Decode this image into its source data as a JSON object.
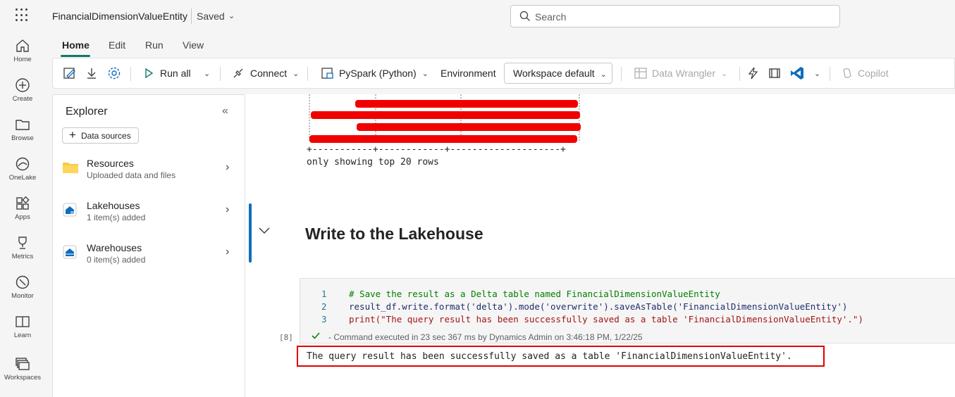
{
  "header": {
    "doc_title": "FinancialDimensionValueEntity",
    "saved_label": "Saved",
    "search_placeholder": "Search"
  },
  "leftnav": {
    "items": [
      {
        "label": "Home",
        "icon": "home-icon"
      },
      {
        "label": "Create",
        "icon": "create-icon"
      },
      {
        "label": "Browse",
        "icon": "browse-icon"
      },
      {
        "label": "OneLake",
        "icon": "onelake-icon"
      },
      {
        "label": "Apps",
        "icon": "apps-icon"
      },
      {
        "label": "Metrics",
        "icon": "metrics-icon"
      },
      {
        "label": "Monitor",
        "icon": "monitor-icon"
      },
      {
        "label": "Learn",
        "icon": "learn-icon"
      },
      {
        "label": "Workspaces",
        "icon": "workspaces-icon"
      }
    ]
  },
  "ribbon": {
    "tabs": [
      "Home",
      "Edit",
      "Run",
      "View"
    ],
    "active_tab": "Home",
    "run_all": "Run all",
    "connect": "Connect",
    "language": "PySpark (Python)",
    "environment": "Environment",
    "workspace": "Workspace default",
    "data_wrangler": "Data Wrangler",
    "copilot": "Copilot"
  },
  "explorer": {
    "title": "Explorer",
    "data_sources_button": "Data sources",
    "items": [
      {
        "name": "Resources",
        "sub": "Uploaded data and files",
        "icon": "folder-icon"
      },
      {
        "name": "Lakehouses",
        "sub": "1 item(s) added",
        "icon": "lakehouse-icon"
      },
      {
        "name": "Warehouses",
        "sub": "0 item(s) added",
        "icon": "warehouse-icon"
      }
    ]
  },
  "notebook": {
    "table_footer": "+-----------+------------+--------------------+",
    "table_note": "only showing top 20 rows",
    "section_heading": "Write to the Lakehouse",
    "code_lines": [
      {
        "num": "1",
        "text": "# Save the result as a Delta table named FinancialDimensionValueEntity"
      },
      {
        "num": "2",
        "text": "result_df.write.format('delta').mode('overwrite').saveAsTable('FinancialDimensionValueEntity')"
      },
      {
        "num": "3",
        "text": "print(\"The query result has been successfully saved as a table 'FinancialDimensionValueEntity'.\")"
      }
    ],
    "exec_count": "[8]",
    "exec_status": "- Command executed in 23 sec 367 ms by Dynamics Admin on 3:46:18 PM, 1/22/25",
    "output_text": "The query result has been successfully saved as a table 'FinancialDimensionValueEntity'."
  },
  "colors": {
    "accent": "#117865",
    "active_cell": "#0f6cbd",
    "highlight": "#e00000"
  }
}
